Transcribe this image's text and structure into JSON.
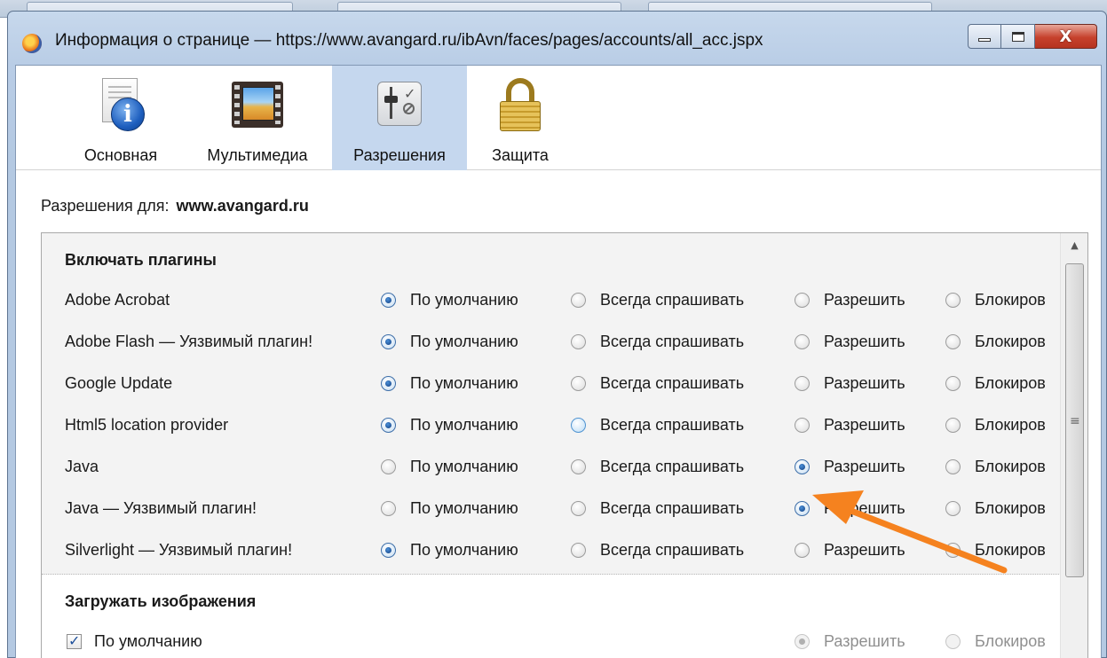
{
  "window": {
    "title": "Информация о странице — https://www.avangard.ru/ibAvn/faces/pages/accounts/all_acc.jspx",
    "close_glyph": "X"
  },
  "toolbar": {
    "tabs": [
      {
        "label": "Основная",
        "icon": "info-icon"
      },
      {
        "label": "Мультимедиа",
        "icon": "multimedia-icon"
      },
      {
        "label": "Разрешения",
        "icon": "permissions-icon",
        "selected": true
      },
      {
        "label": "Защита",
        "icon": "lock-icon"
      }
    ]
  },
  "permissions": {
    "label": "Разрешения для:",
    "host": "www.avangard.ru"
  },
  "options": {
    "default": "По умолчанию",
    "ask": "Всегда спрашивать",
    "allow": "Разрешить",
    "block": "Блокиров"
  },
  "plugins": {
    "title": "Включать плагины",
    "rows": [
      {
        "name": "Adobe Acrobat",
        "selected": "default"
      },
      {
        "name": "Adobe Flash — Уязвимый плагин!",
        "selected": "default"
      },
      {
        "name": "Google Update",
        "selected": "default"
      },
      {
        "name": "Html5 location provider",
        "selected": "default",
        "hover": "ask"
      },
      {
        "name": "Java",
        "selected": "allow"
      },
      {
        "name": "Java — Уязвимый плагин!",
        "selected": "allow"
      },
      {
        "name": "Silverlight — Уязвимый плагин!",
        "selected": "default"
      }
    ]
  },
  "images": {
    "title": "Загружать изображения",
    "default_label": "По умолчанию",
    "default_checked": true,
    "allow": "Разрешить",
    "block": "Блокиров",
    "selected": "allow"
  },
  "colors": {
    "selected_tab": "#c5d7ee",
    "annotation_arrow": "#f5821f"
  }
}
